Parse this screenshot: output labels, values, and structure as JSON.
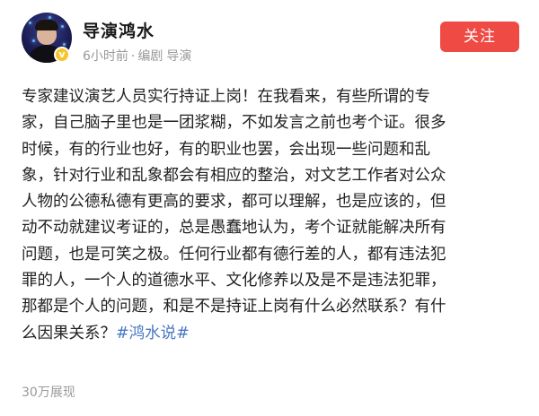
{
  "author": {
    "name": "导演鸿水",
    "avatar_icon": "person-avatar",
    "verified_icon": "verified-v-badge",
    "verified_color": "#f7c52b"
  },
  "meta": {
    "time": "6小时前",
    "separator": "·",
    "role": "编剧",
    "tag": "导演"
  },
  "follow_button": {
    "label": "关注",
    "color": "#f04a45"
  },
  "post": {
    "lines": [
      "专家建议演艺人员实行持证上岗！在我看来，有些所谓的专",
      "家，自己脑子里也是一团浆糊，不如发言之前也考个证。很多",
      "时候，有的行业也好，有的职业也罢，会出现一些问题和乱",
      "象，针对行业和乱象都会有相应的整治，对文艺工作者对公众",
      "人物的公德私德有更高的要求，都可以理解，也是应该的，但",
      "动不动就建议考证的，总是愚蠢地认为，考个证就能解决所有",
      "问题，也是可笑之极。任何行业都有德行差的人，都有违法犯",
      "罪的人，一个人的道德水平、文化修养以及是不是违法犯罪，",
      "那都是个人的问题，和是不是持证上岗有什么必然联系？有什"
    ],
    "last_line_text": "么因果关系？",
    "hashtag": "#鸿水说#",
    "hashtag_color": "#4a78c2"
  },
  "stats": {
    "views": "30万展现"
  }
}
